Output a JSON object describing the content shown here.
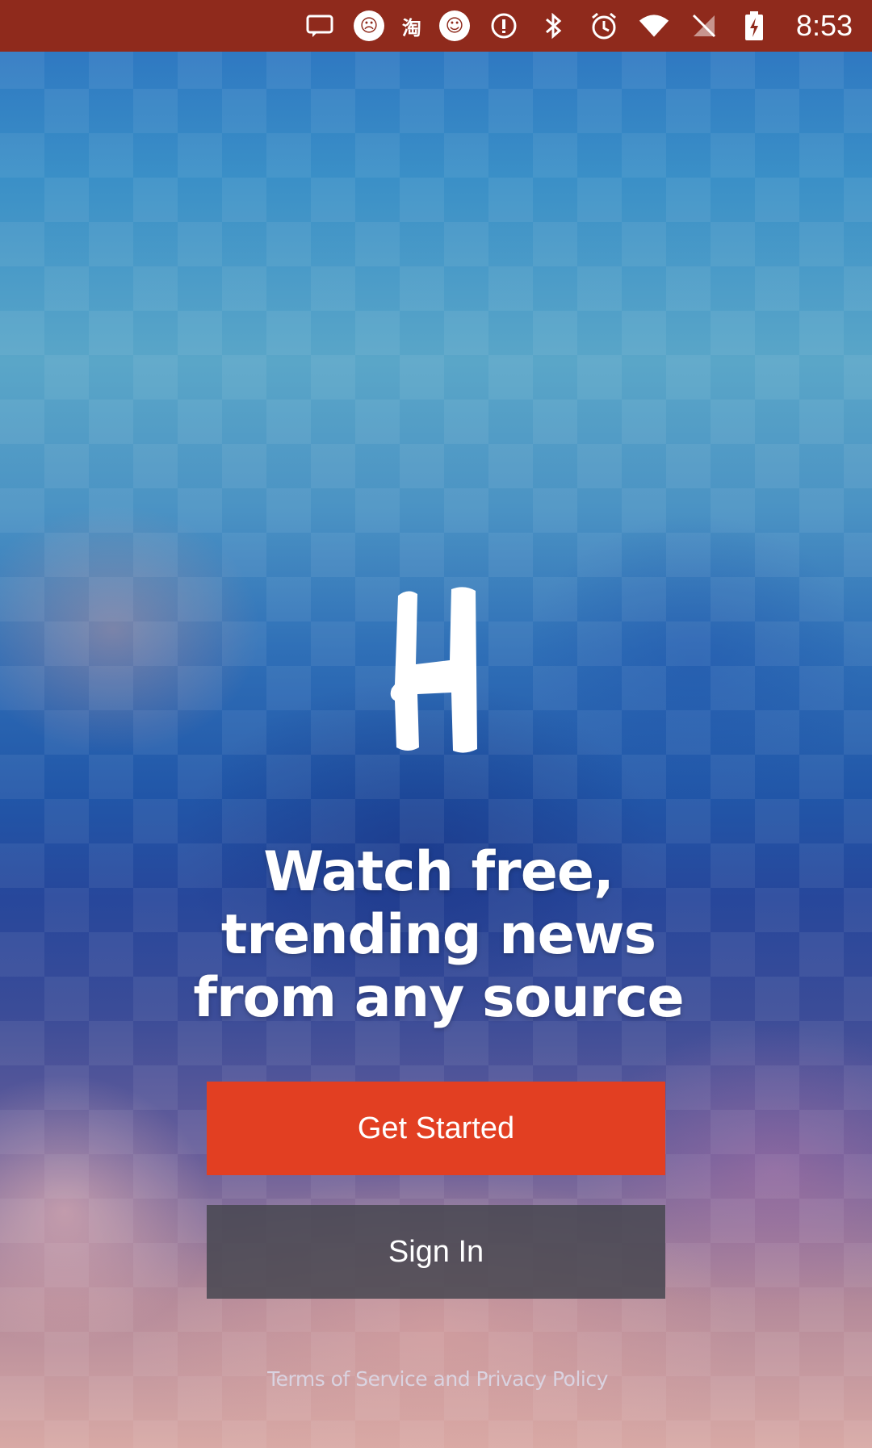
{
  "status_bar": {
    "time": "8:53",
    "notification_icons": [
      "message-icon",
      "emoji-icon",
      "taobao-icon",
      "smiley-icon",
      "info-icon"
    ],
    "system_icons": [
      "bluetooth-icon",
      "alarm-icon",
      "wifi-icon",
      "no-sim-icon",
      "battery-charging-icon"
    ],
    "taobao_glyph": "淘",
    "background_color": "#8f2a1c"
  },
  "logo": {
    "letter": "H",
    "icon": "brand-logo-icon"
  },
  "main": {
    "headline": "Watch free, trending news from any source",
    "get_started_label": "Get Started",
    "sign_in_label": "Sign In",
    "terms_text": "Terms of Service and Privacy Policy"
  },
  "colors": {
    "primary_button": "#e23f22",
    "secondary_button": "#464650",
    "text": "#ffffff"
  }
}
